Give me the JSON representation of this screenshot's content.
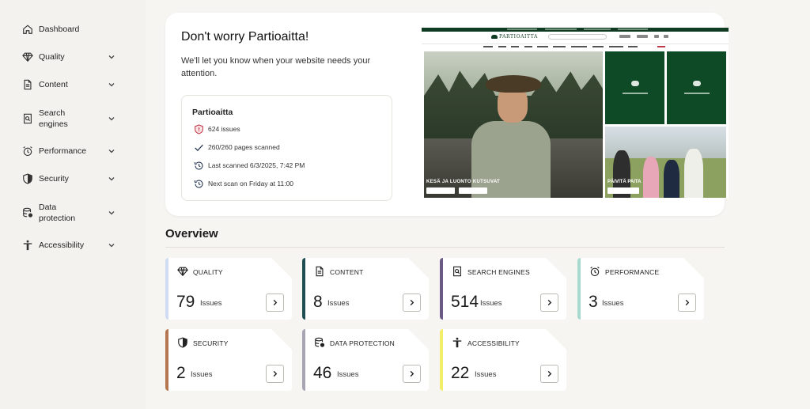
{
  "sidebar": {
    "items": [
      {
        "label": "Dashboard",
        "icon": "home-icon"
      },
      {
        "label": "Quality",
        "icon": "diamond-icon"
      },
      {
        "label": "Content",
        "icon": "document-icon"
      },
      {
        "label": "Search\nengines",
        "icon": "search-document-icon"
      },
      {
        "label": "Performance",
        "icon": "alarm-clock-icon"
      },
      {
        "label": "Security",
        "icon": "shield-icon"
      },
      {
        "label": "Data\nprotection",
        "icon": "database-icon"
      },
      {
        "label": "Accessibility",
        "icon": "accessibility-person-icon"
      }
    ]
  },
  "hero": {
    "title": "Don't worry Partioaitta!",
    "subtitle": "We'll let you know when your website needs your attention.",
    "site": {
      "name": "Partioaitta",
      "issues": "624 issues",
      "pages": "260/260 pages scanned",
      "last_scan": "Last scanned 6/3/2025, 7:42 PM",
      "next_scan": "Next scan on Friday at 11:00"
    },
    "preview": {
      "logo": "PARTIOAITTA",
      "main_caption": "KESÄ JA LUONTO KUTSUVAT",
      "secondary_caption": "PÄIVITÄ PAITA"
    }
  },
  "overview": {
    "title": "Overview",
    "issues_label": "Issues",
    "cards": [
      {
        "title": "QUALITY",
        "count": "79",
        "icon": "diamond-icon",
        "color": "#cfdcf3"
      },
      {
        "title": "CONTENT",
        "count": "8",
        "icon": "document-icon",
        "color": "#1f4f52"
      },
      {
        "title": "SEARCH ENGINES",
        "count": "514",
        "icon": "search-document-icon",
        "color": "#6b5a86"
      },
      {
        "title": "PERFORMANCE",
        "count": "3",
        "icon": "alarm-clock-icon",
        "color": "#a7d9cf"
      },
      {
        "title": "SECURITY",
        "count": "2",
        "icon": "shield-icon",
        "color": "#b5754f"
      },
      {
        "title": "DATA PROTECTION",
        "count": "46",
        "icon": "database-icon",
        "color": "#a9a4b3"
      },
      {
        "title": "ACCESSIBILITY",
        "count": "22",
        "icon": "accessibility-person-icon",
        "color": "#f3ee6a"
      }
    ]
  },
  "colors": {
    "background": "#f4f2ee",
    "card": "#ffffff",
    "issue_shield": "#c0394b",
    "brand_green": "#0f4a27"
  }
}
